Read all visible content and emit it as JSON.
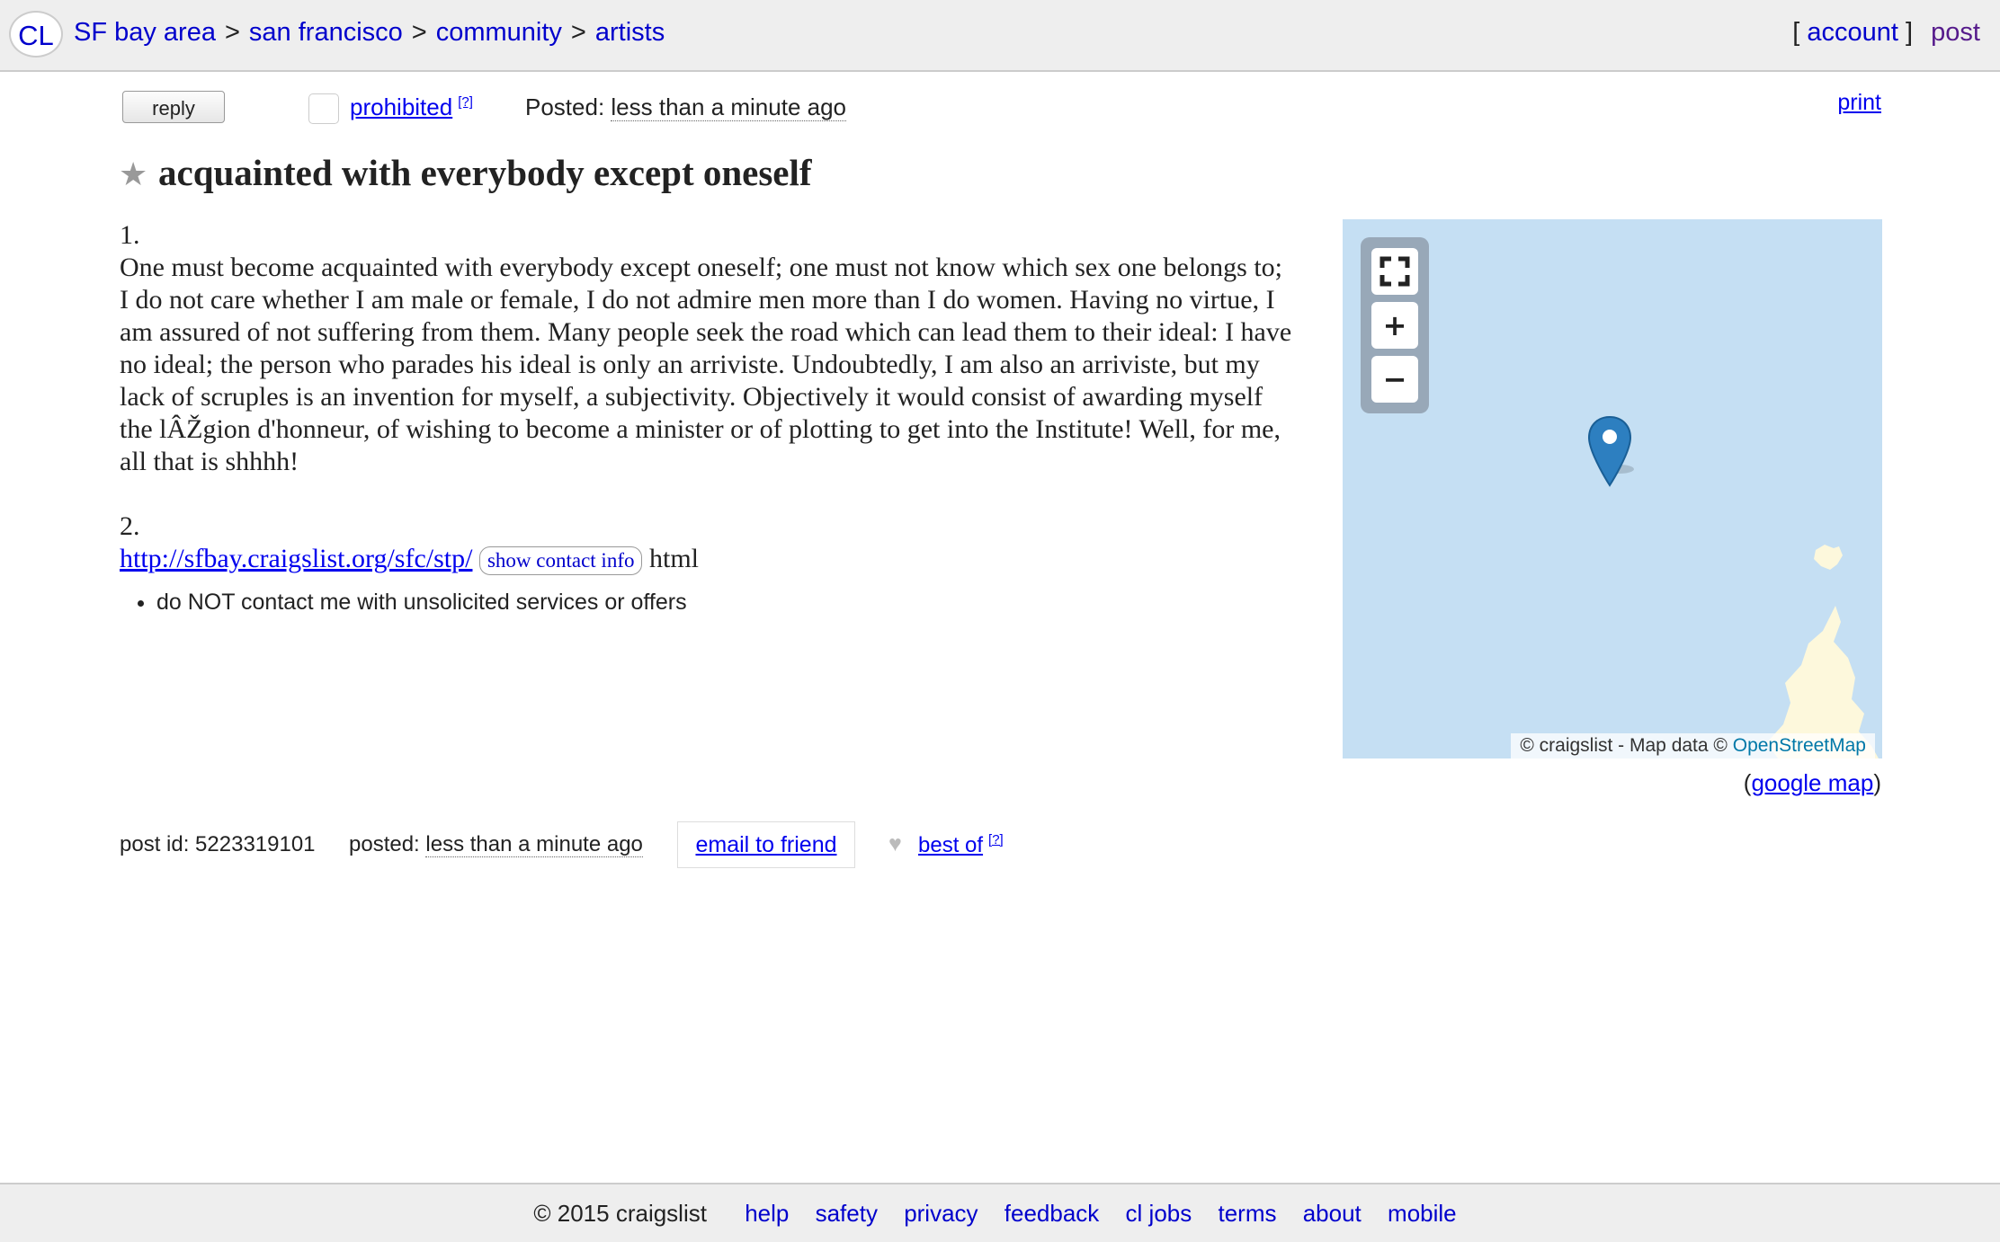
{
  "header": {
    "logo": "CL",
    "breadcrumb": [
      "SF bay area",
      "san francisco",
      "community",
      "artists"
    ],
    "separator": ">",
    "account_open": "[",
    "account": "account",
    "account_close": "]",
    "post": "post"
  },
  "actions": {
    "reply": "reply",
    "prohibited": "prohibited",
    "help_mark": "[?]",
    "posted_label": "Posted:",
    "posted_value": "less than a minute ago",
    "print": "print"
  },
  "post": {
    "title": "acquainted with everybody except oneself",
    "p1_num": "1.",
    "p1_text": "One must become acquainted with everybody except oneself; one must not know which sex one belongs to; I do not care whether I am male or female, I do not admire men more than I do women. Having no virtue, I am assured of not suffering from them. Many people seek the road which can lead them to their ideal: I have no ideal; the person who parades his ideal is only an arriviste. Undoubtedly, I am also an arriviste, but my lack of scruples is an invention for myself, a subjectivity. Objectively it would consist of awarding myself the lÂŽgion d'honneur, of wishing to become a minister or of plotting to get into the Institute! Well, for me, all that is shhhh!",
    "p2_num": "2.",
    "link": "http://sfbay.craigslist.org/sfc/stp/",
    "contact_btn": "show contact info",
    "after_link": "html",
    "notice": "do NOT contact me with unsolicited services or offers"
  },
  "map": {
    "controls": [
      "fullscreen-icon",
      "zoom-in-icon",
      "zoom-out-icon"
    ],
    "attribution_prefix": "© craigslist - Map data ©",
    "attribution_link": "OpenStreetMap",
    "google_open": "(",
    "google_map": "google map",
    "google_close": ")"
  },
  "postinfo": {
    "post_id": "post id: 5223319101",
    "posted_label": "posted:",
    "posted_value": "less than a minute ago",
    "email_friend": "email to friend",
    "best_of": "best of",
    "help_mark": "[?]"
  },
  "footer": {
    "copyright": "© 2015 craigslist",
    "links": [
      "help",
      "safety",
      "privacy",
      "feedback",
      "cl jobs",
      "terms",
      "about",
      "mobile"
    ]
  },
  "colors": {
    "link": "#0000cc",
    "visited": "#551a8b",
    "header_bg": "#eeeeee",
    "map_water": "#c5dff3",
    "map_land": "#fdf8dc",
    "pin": "#2d7fc0"
  }
}
